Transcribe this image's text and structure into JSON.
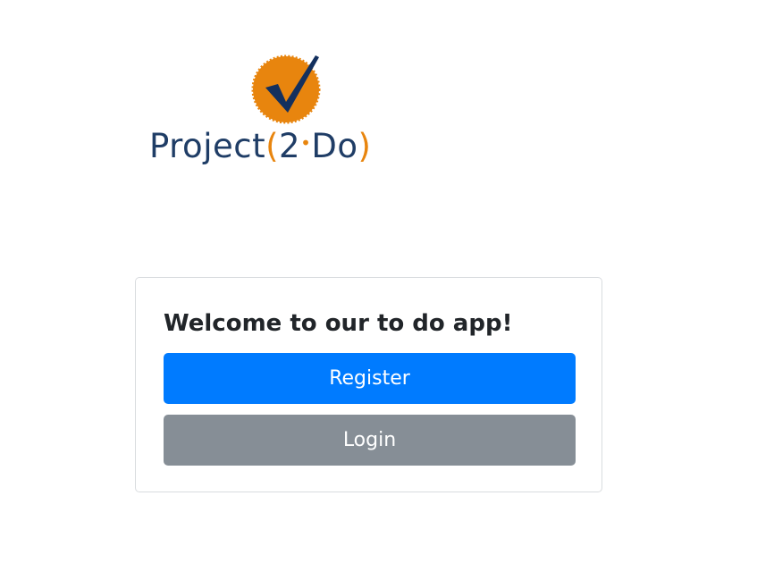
{
  "logo": {
    "word_main": "Project",
    "paren_open": "(",
    "num": "2",
    "word_do": "Do",
    "paren_close": ")",
    "colors": {
      "navy": "#1f3d66",
      "orange": "#e8850e",
      "check": "#13305e"
    }
  },
  "card": {
    "title": "Welcome to our to do app!",
    "register_label": "Register",
    "login_label": "Login"
  },
  "colors": {
    "primary": "#007bff",
    "secondary": "#868e96",
    "text": "#212529",
    "border": "#d9dcdf"
  }
}
